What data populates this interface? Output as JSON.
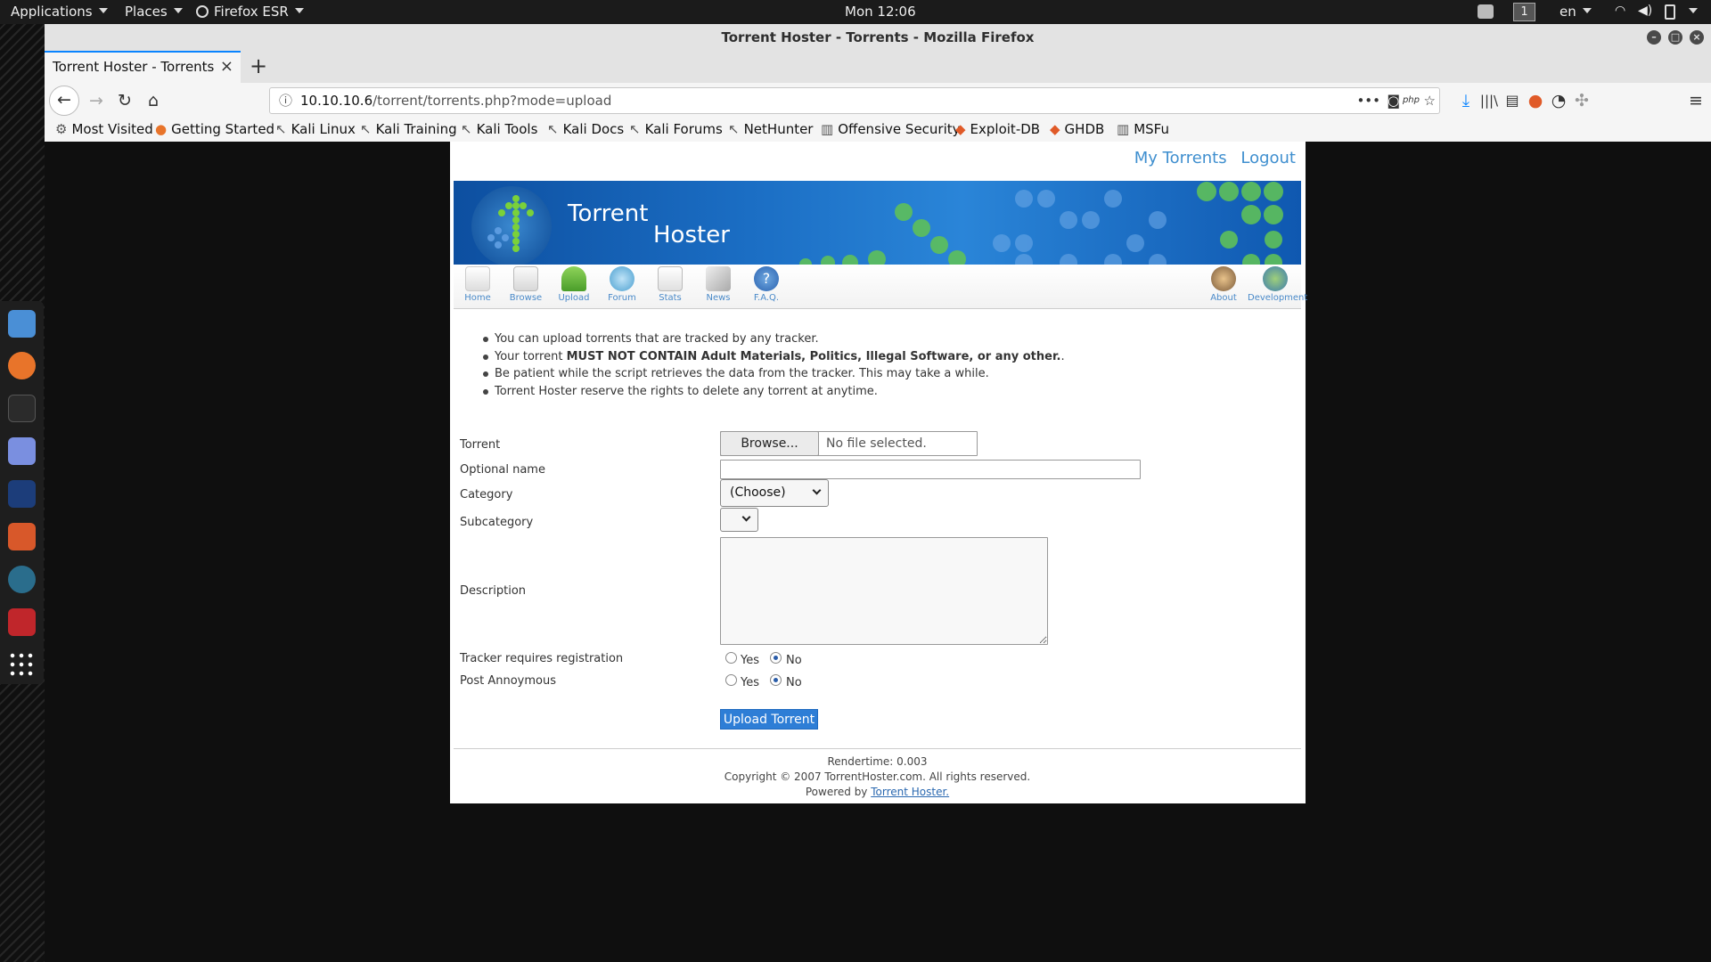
{
  "topbar": {
    "applications": "Applications",
    "places": "Places",
    "firefox": "Firefox ESR",
    "clock": "Mon 12:06",
    "workspace": "1",
    "lang": "en"
  },
  "window": {
    "title": "Torrent Hoster - Torrents - Mozilla Firefox"
  },
  "tabs": [
    {
      "label": "Torrent Hoster - Torrents"
    }
  ],
  "url": {
    "host": "10.10.10.6",
    "path": "/torrent/torrents.php?mode=upload"
  },
  "bookmarks": [
    {
      "label": "Most Visited"
    },
    {
      "label": "Getting Started"
    },
    {
      "label": "Kali Linux"
    },
    {
      "label": "Kali Training"
    },
    {
      "label": "Kali Tools"
    },
    {
      "label": "Kali Docs"
    },
    {
      "label": "Kali Forums"
    },
    {
      "label": "NetHunter"
    },
    {
      "label": "Offensive Security"
    },
    {
      "label": "Exploit-DB"
    },
    {
      "label": "GHDB"
    },
    {
      "label": "MSFu"
    }
  ],
  "site": {
    "top_links": {
      "my_torrents": "My Torrents",
      "logout": "Logout"
    },
    "banner": {
      "line1": "Torrent",
      "line2": "Hoster"
    },
    "menu": [
      {
        "label": "Home"
      },
      {
        "label": "Browse"
      },
      {
        "label": "Upload"
      },
      {
        "label": "Forum"
      },
      {
        "label": "Stats"
      },
      {
        "label": "News"
      },
      {
        "label": "F.A.Q."
      },
      {
        "label": "About"
      },
      {
        "label": "Development"
      }
    ],
    "notes": [
      {
        "text": "You can upload torrents that are tracked by any tracker."
      },
      {
        "pre": "Your torrent ",
        "bold": "MUST NOT CONTAIN Adult Materials, Politics, Illegal Software, or any other.",
        "post": "."
      },
      {
        "text": "Be patient while the script retrieves the data from the tracker. This may take a while."
      },
      {
        "text": "Torrent Hoster reserve the rights to delete any torrent at anytime."
      }
    ],
    "form": {
      "torrent_label": "Torrent",
      "browse_label": "Browse...",
      "file_status": "No file selected.",
      "optional_name_label": "Optional name",
      "optional_name_value": "",
      "category_label": "Category",
      "category_value": "(Choose)",
      "subcategory_label": "Subcategory",
      "subcategory_value": "",
      "description_label": "Description",
      "description_value": "",
      "tracker_label": "Tracker requires registration",
      "post_label": "Post Annoymous",
      "yes": "Yes",
      "no": "No",
      "tracker_selected": "No",
      "post_selected": "No",
      "submit_label": "Upload Torrent"
    },
    "footer": {
      "rendertime": "Rendertime: 0.003",
      "copyright": "Copyright © 2007 TorrentHoster.com. All rights reserved.",
      "powered_prefix": "Powered by ",
      "powered_link": "Torrent Hoster."
    }
  },
  "colors": {
    "accent": "#0a84ff",
    "link": "#3f8fcf",
    "submit": "#2e7ed6"
  }
}
